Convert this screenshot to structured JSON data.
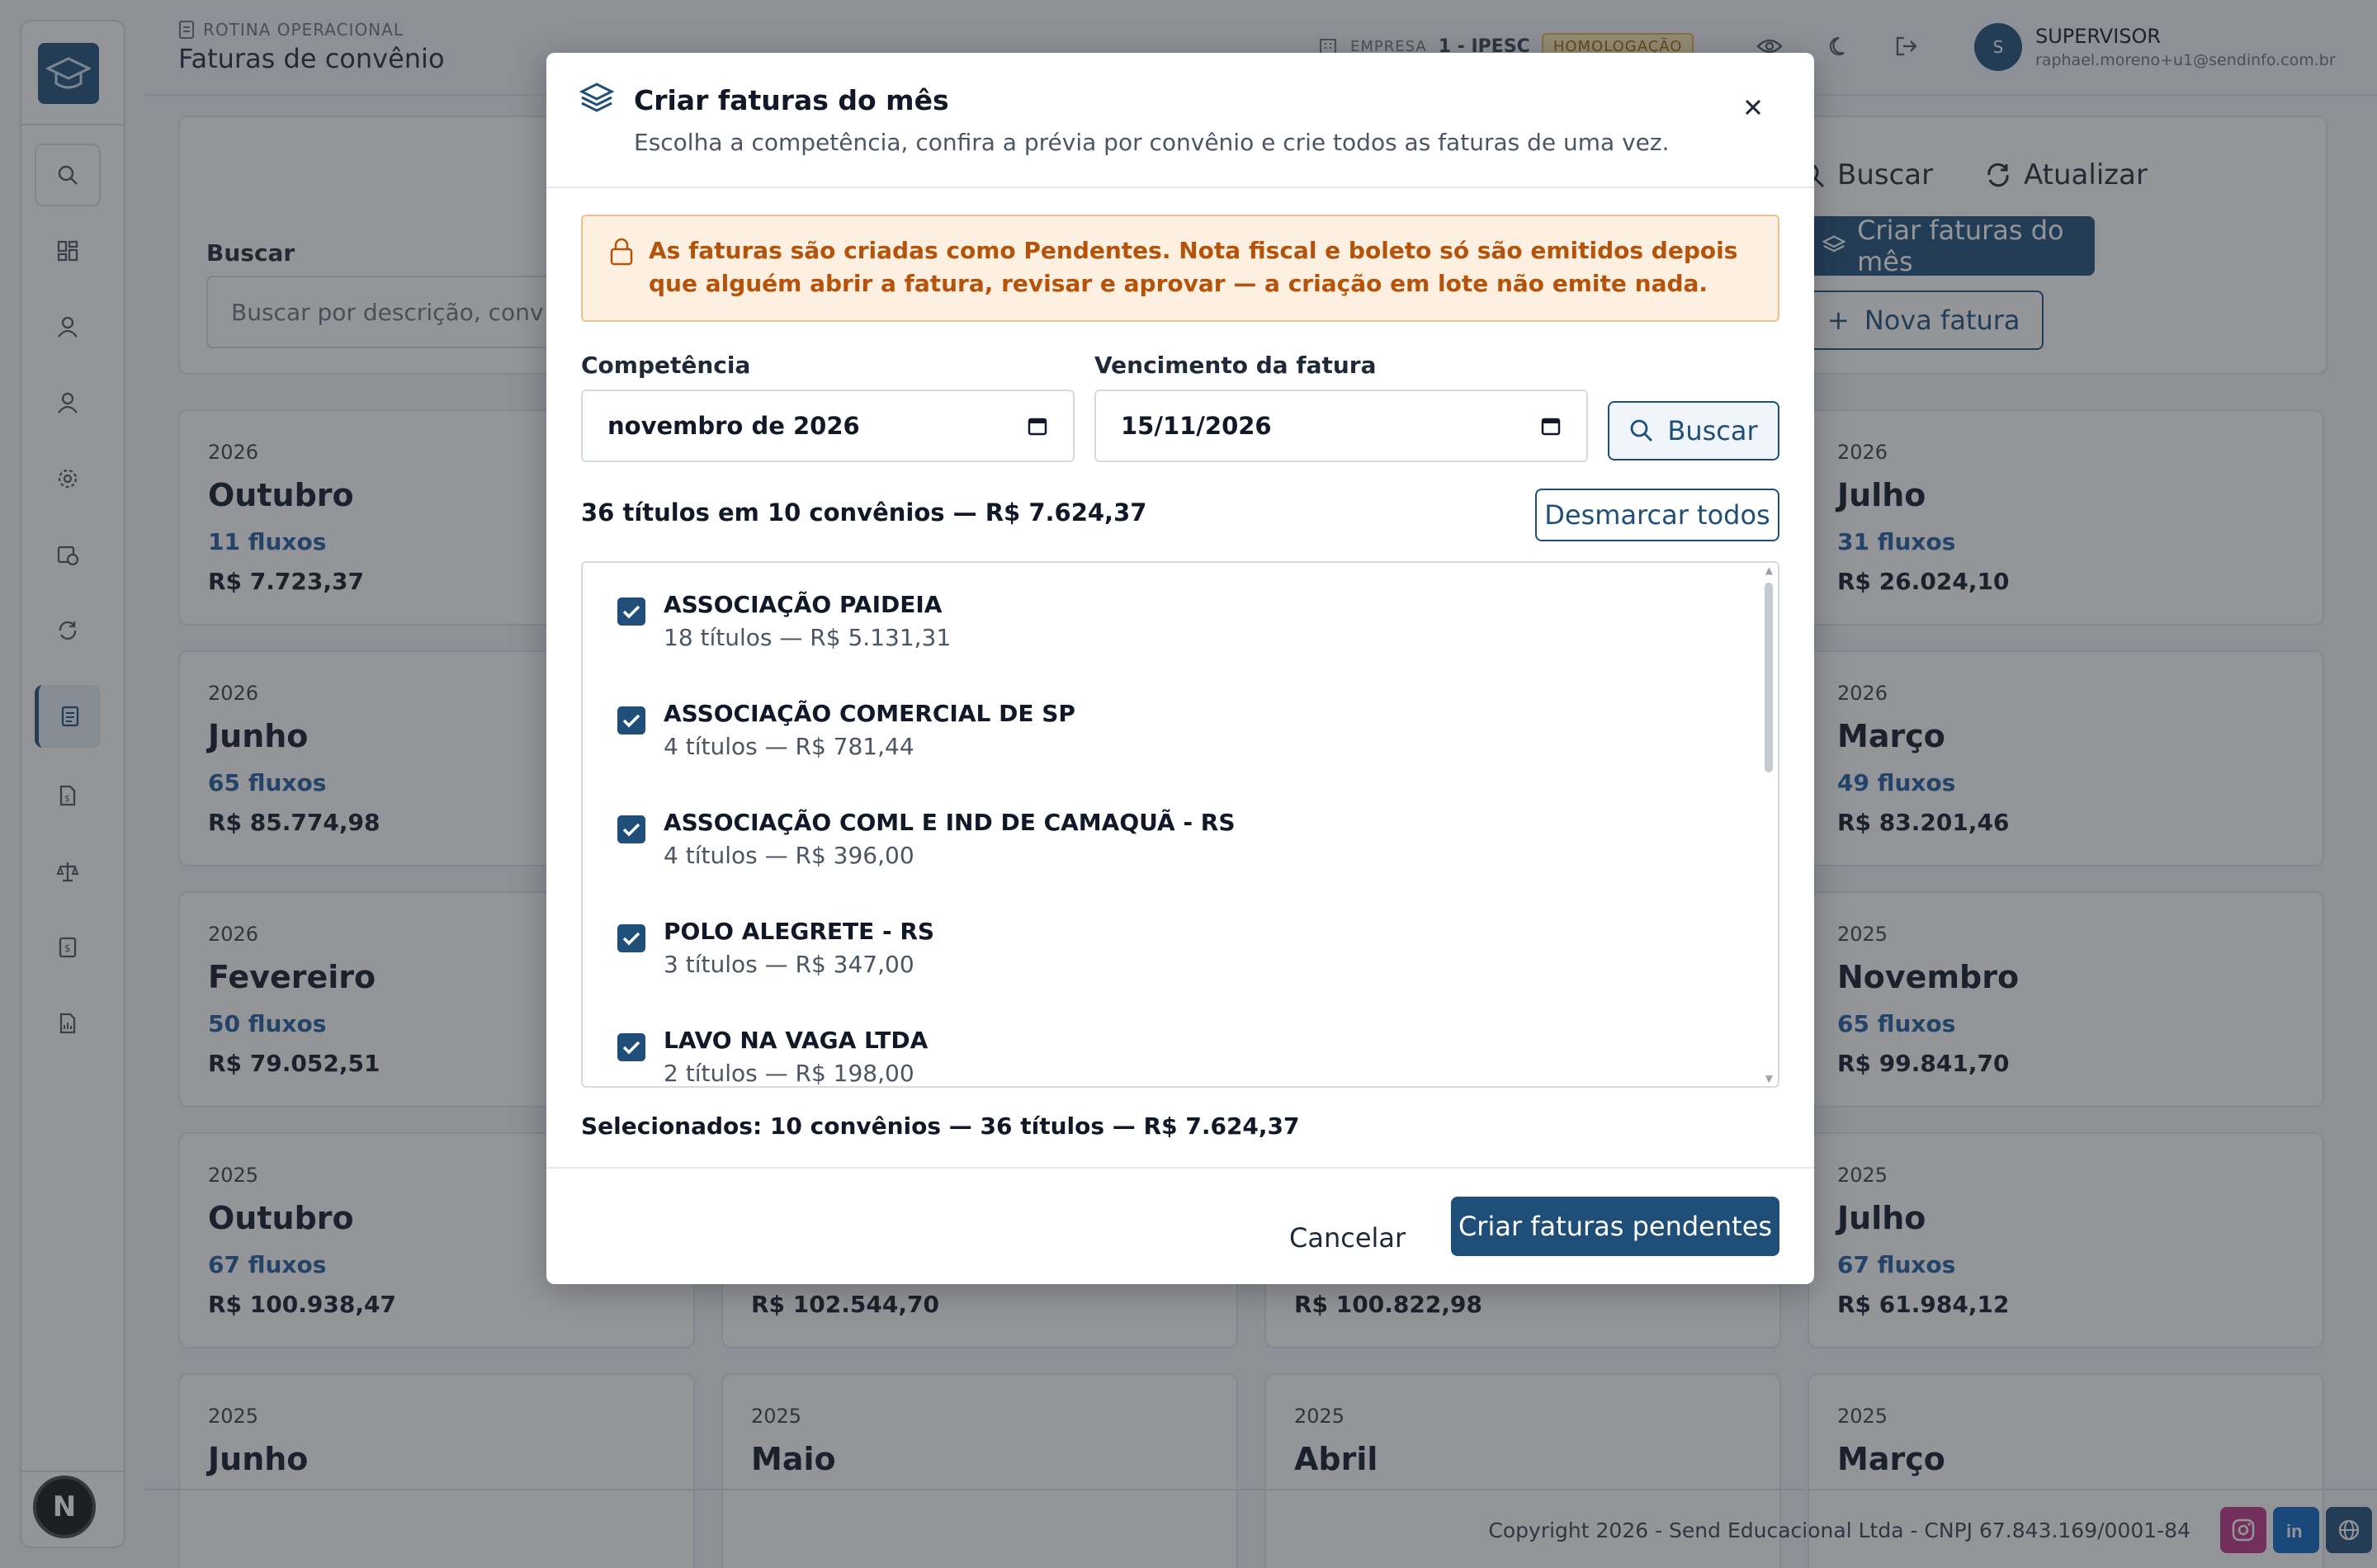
{
  "header": {
    "section": "ROTINA OPERACIONAL",
    "title": "Faturas de convênio",
    "company_label": "EMPRESA",
    "company_value": "1 - IPESC",
    "env_tag": "HOMOLOGAÇÃO",
    "user_initial": "S",
    "user_name": "SUPERVISOR",
    "user_email": "raphael.moreno+u1@sendinfo.com.br"
  },
  "sidebar": {
    "items": [
      "search-icon",
      "dashboard-icon",
      "user-icon",
      "user-icon",
      "gear-icon",
      "calendar-clock-icon",
      "refresh-icon",
      "document-icon",
      "file-money-icon",
      "scale-icon",
      "dollar-doc-icon",
      "report-icon"
    ],
    "badge": "N"
  },
  "filter": {
    "search_label": "Buscar",
    "search_placeholder": "Buscar por descrição, conv",
    "buscar_btn": "Buscar",
    "atualizar_btn": "Atualizar",
    "criar_btn": "Criar faturas do mês",
    "nova_btn": "Nova fatura"
  },
  "cards": [
    {
      "year": "2026",
      "month": "Outubro",
      "flows": "11 fluxos",
      "total": "R$ 7.723,37"
    },
    {
      "year": "2026",
      "month": "Julho",
      "flows": "31 fluxos",
      "total": "R$ 26.024,10"
    },
    {
      "year": "2026",
      "month": "Junho",
      "flows": "65 fluxos",
      "total": "R$ 85.774,98"
    },
    {
      "year": "2026",
      "month": "Março",
      "flows": "49 fluxos",
      "total": "R$ 83.201,46"
    },
    {
      "year": "2026",
      "month": "Fevereiro",
      "flows": "50 fluxos",
      "total": "R$ 79.052,51"
    },
    {
      "year": "2025",
      "month": "Novembro",
      "flows": "65 fluxos",
      "total": "R$ 99.841,70"
    },
    {
      "year": "2025",
      "month": "Outubro",
      "flows": "67 fluxos",
      "total": "R$ 100.938,47"
    },
    {
      "year": "",
      "month": "",
      "flows": "",
      "total": "R$ 102.544,70"
    },
    {
      "year": "",
      "month": "",
      "flows": "",
      "total": "R$ 100.822,98"
    },
    {
      "year": "2025",
      "month": "Julho",
      "flows": "67 fluxos",
      "total": "R$ 61.984,12"
    },
    {
      "year": "2025",
      "month": "Junho",
      "flows": "",
      "total": ""
    },
    {
      "year": "2025",
      "month": "Maio",
      "flows": "",
      "total": ""
    },
    {
      "year": "2025",
      "month": "Abril",
      "flows": "",
      "total": ""
    },
    {
      "year": "2025",
      "month": "Março",
      "flows": "",
      "total": ""
    }
  ],
  "footer": {
    "copyright": "Copyright 2026 - Send Educacional Ltda - CNPJ 67.843.169/0001-84"
  },
  "modal": {
    "title": "Criar faturas do mês",
    "subtitle": "Escolha a competência, confira a prévia por convênio e crie todos as faturas de uma vez.",
    "alert": "As faturas são criadas como Pendentes. Nota fiscal e boleto só são emitidos depois que alguém abrir a fatura, revisar e aprovar — a criação em lote não emite nada.",
    "competencia_label": "Competência",
    "competencia_value": "novembro de 2026",
    "vencimento_label": "Vencimento da fatura",
    "vencimento_value": "15/11/2026",
    "buscar_btn": "Buscar",
    "summary": "36 títulos em 10 convênios — R$ 7.624,37",
    "desmarcar_btn": "Desmarcar todos",
    "items": [
      {
        "name": "ASSOCIAÇÃO PAIDEIA",
        "meta": "18 títulos — R$ 5.131,31",
        "checked": true
      },
      {
        "name": "ASSOCIAÇÃO COMERCIAL DE SP",
        "meta": "4 títulos — R$ 781,44",
        "checked": true
      },
      {
        "name": "ASSOCIAÇÃO COML E IND DE CAMAQUÃ - RS",
        "meta": "4 títulos — R$ 396,00",
        "checked": true
      },
      {
        "name": "POLO ALEGRETE - RS",
        "meta": "3 títulos — R$ 347,00",
        "checked": true
      },
      {
        "name": "LAVO NA VAGA LTDA",
        "meta": "2 títulos — R$ 198,00",
        "checked": true
      }
    ],
    "selected": "Selecionados: 10 convênios — 36 títulos — R$ 7.624,37",
    "cancel_btn": "Cancelar",
    "create_btn": "Criar faturas pendentes"
  }
}
